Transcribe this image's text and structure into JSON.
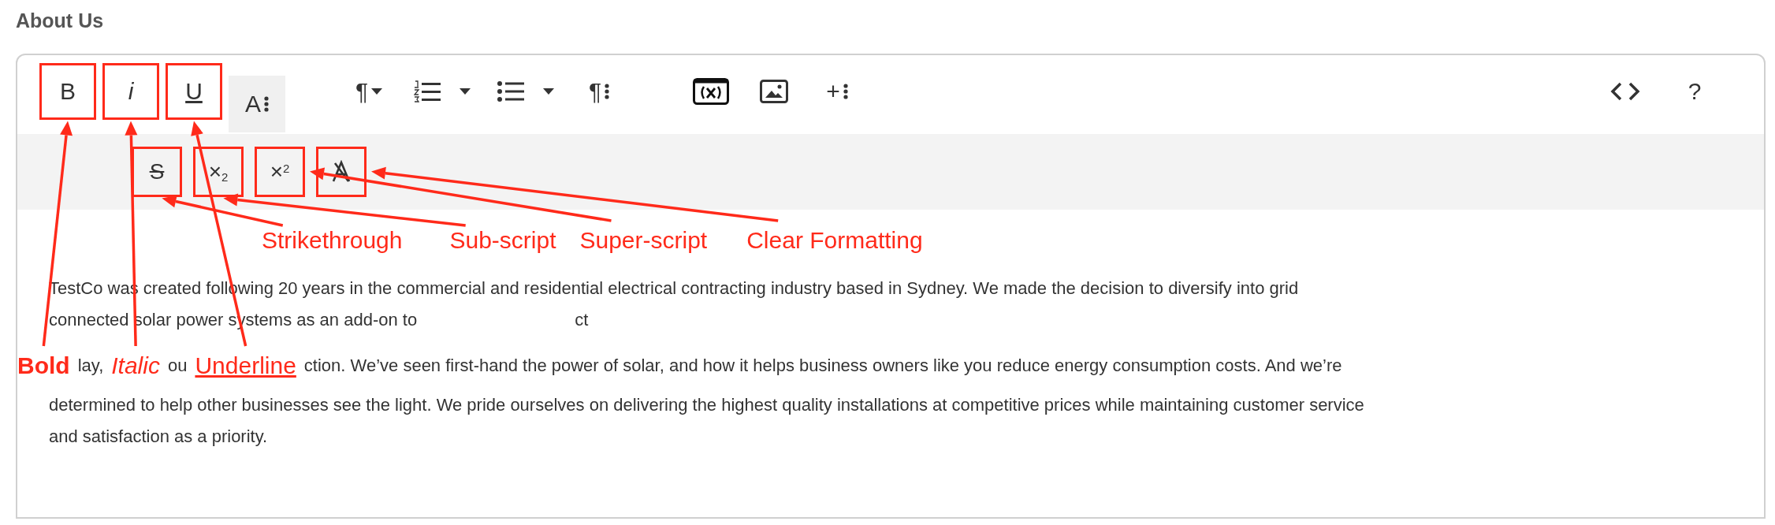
{
  "section_title": "About Us",
  "toolbar": {
    "groups": [
      [
        {
          "kind": "bold",
          "label": "B",
          "callout": {
            "label": "Bold"
          }
        },
        {
          "kind": "italic",
          "label": "i",
          "callout": {
            "label": "Italic"
          }
        },
        {
          "kind": "underline",
          "label": "U",
          "callout": {
            "label": "Underline"
          }
        },
        {
          "kind": "font-size",
          "label": "A",
          "expanded": true
        }
      ],
      [
        {
          "kind": "paragraph-format",
          "label": "¶"
        },
        {
          "kind": "ordered-list"
        },
        {
          "kind": "bullet-list"
        },
        {
          "kind": "paragraph-more",
          "label": "¶"
        }
      ],
      [
        {
          "kind": "variable"
        },
        {
          "kind": "image"
        },
        {
          "kind": "insert-more",
          "label": "+"
        }
      ]
    ],
    "end": [
      {
        "kind": "code-view"
      },
      {
        "kind": "help",
        "label": "?"
      }
    ],
    "more": [
      {
        "kind": "strikethrough",
        "label": "S",
        "callout": {
          "label": "Strikethrough"
        }
      },
      {
        "kind": "subscript",
        "label": "×$_{2}$",
        "callout": {
          "label": "Sub-script"
        }
      },
      {
        "kind": "superscript",
        "label": "×$^{2}$",
        "callout": {
          "label": "Super-script"
        }
      },
      {
        "kind": "clear-formatting",
        "callout": {
          "label": "Clear Formatting"
        }
      }
    ]
  },
  "body": {
    "lines": [
      {
        "kind": "callouts"
      },
      {
        "kind": "text",
        "parts": [
          "TestCo was created following 20 years in the commercial and residential electrical contracting industry based in Sydney. We made the decision to diversify into grid"
        ]
      },
      {
        "kind": "text",
        "parts": [
          "connected solar power systems as an add-on to",
          "ct"
        ]
      },
      {
        "kind": "callout-text",
        "parts": [
          "lay,",
          "ou",
          "ction. We’ve seen first-hand the power of solar, and how it helps business owners like you reduce energy consumption costs. And we’re"
        ]
      },
      {
        "kind": "text",
        "parts": [
          "determined to help other businesses see the light. We pride ourselves on delivering the highest quality installations at competitive prices while maintaining customer service"
        ]
      },
      {
        "kind": "text",
        "parts": [
          "and satisfaction as a priority."
        ]
      }
    ]
  }
}
